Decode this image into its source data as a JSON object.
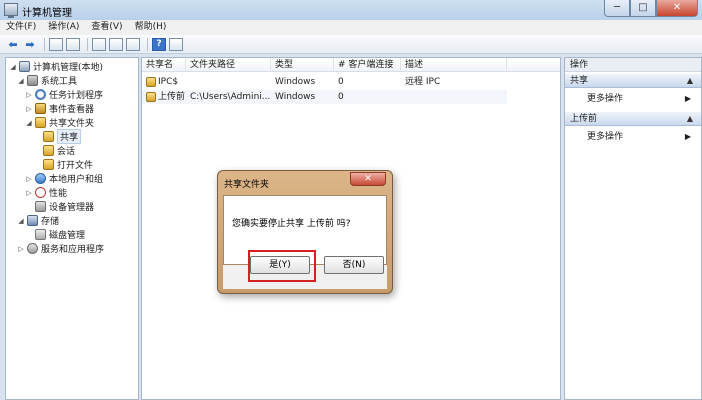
{
  "window": {
    "title": "计算机管理",
    "controls": {
      "minimize": "─",
      "maximize": "□",
      "close": "✕"
    }
  },
  "menu": [
    "文件(F)",
    "操作(A)",
    "查看(V)",
    "帮助(H)"
  ],
  "toolbar": {
    "help_label": "?"
  },
  "tree": [
    {
      "label": "计算机管理(本地)",
      "toggle": "◢",
      "icon": "computer-icon"
    },
    {
      "label": "系统工具",
      "toggle": "◢",
      "icon": "tools-icon"
    },
    {
      "label": "任务计划程序",
      "toggle": "▷",
      "icon": "clock-icon"
    },
    {
      "label": "事件查看器",
      "toggle": "▷",
      "icon": "event-icon"
    },
    {
      "label": "共享文件夹",
      "toggle": "◢",
      "icon": "share-icon"
    },
    {
      "label": "共享",
      "toggle": "",
      "icon": "share-icon",
      "selected": true
    },
    {
      "label": "会话",
      "toggle": "",
      "icon": "share-icon"
    },
    {
      "label": "打开文件",
      "toggle": "",
      "icon": "share-icon"
    },
    {
      "label": "本地用户和组",
      "toggle": "▷",
      "icon": "users-icon"
    },
    {
      "label": "性能",
      "toggle": "▷",
      "icon": "performance-icon"
    },
    {
      "label": "设备管理器",
      "toggle": "",
      "icon": "device-icon"
    },
    {
      "label": "存储",
      "toggle": "◢",
      "icon": "storage-icon"
    },
    {
      "label": "磁盘管理",
      "toggle": "",
      "icon": "disk-icon"
    },
    {
      "label": "服务和应用程序",
      "toggle": "▷",
      "icon": "service-icon"
    }
  ],
  "list": {
    "columns": [
      "共享名",
      "文件夹路径",
      "类型",
      "# 客户端连接",
      "描述"
    ],
    "rows": [
      {
        "name": "IPC$",
        "path": "",
        "type": "Windows",
        "clients": "0",
        "desc": "远程 IPC"
      },
      {
        "name": "上传前",
        "path": "C:\\Users\\Admini...",
        "type": "Windows",
        "clients": "0",
        "desc": ""
      }
    ]
  },
  "actions": {
    "header": "操作",
    "sections": [
      {
        "title": "共享",
        "item": "更多操作"
      },
      {
        "title": "上传前",
        "item": "更多操作"
      }
    ],
    "caret_up": "▲",
    "caret_right": "▶"
  },
  "dialog": {
    "title": "共享文件夹",
    "close": "✕",
    "message": "您确实要停止共享 上传前 吗?",
    "yes": "是(Y)",
    "no": "否(N)"
  },
  "colors": {
    "highlight": "#d42020",
    "dialog_frame": "#c79c6b",
    "selection": "#e5eef9"
  }
}
